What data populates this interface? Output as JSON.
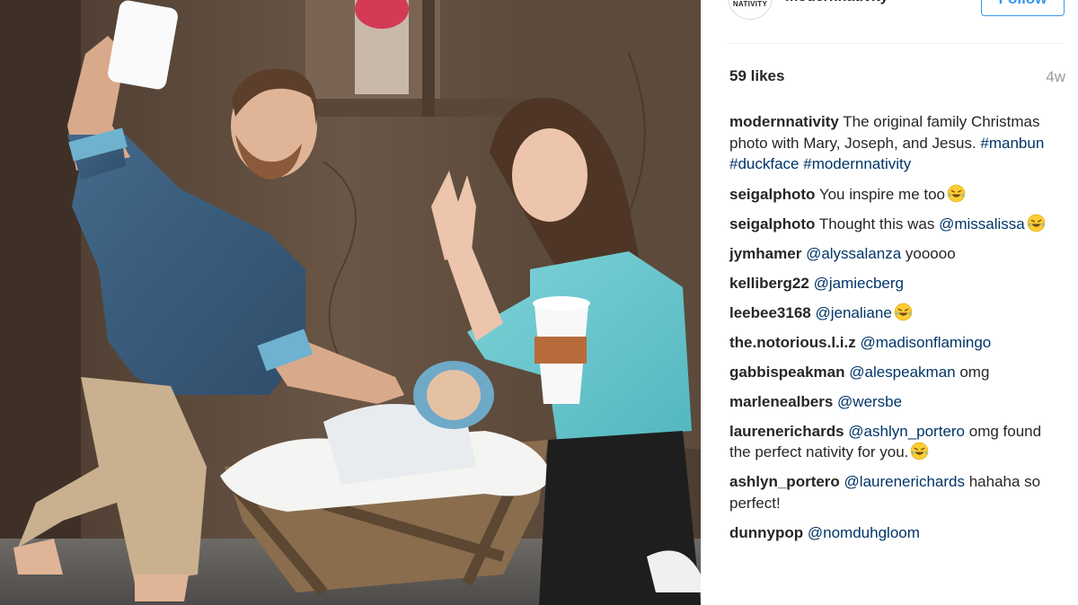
{
  "post": {
    "header": {
      "avatar_text": "NATIVITY",
      "username": "modernnativity",
      "follow_label": "Follow"
    },
    "likes": "59 likes",
    "age": "4w",
    "comments": [
      {
        "user": "modernnativity",
        "parts": [
          {
            "t": "The original family Christmas photo with Mary, Joseph, and Jesus. ",
            "k": "text"
          },
          {
            "t": "#manbun",
            "k": "tag"
          },
          {
            "t": " ",
            "k": "text"
          },
          {
            "t": "#duckface",
            "k": "tag"
          },
          {
            "t": " ",
            "k": "text"
          },
          {
            "t": "#modernnativity",
            "k": "tag"
          }
        ],
        "emoji": false
      },
      {
        "user": "seigalphoto",
        "parts": [
          {
            "t": "You inspire me too",
            "k": "text"
          }
        ],
        "emoji": true
      },
      {
        "user": "seigalphoto",
        "parts": [
          {
            "t": "Thought this was ",
            "k": "text"
          },
          {
            "t": "@missalissa",
            "k": "tag"
          }
        ],
        "emoji": true
      },
      {
        "user": "jymhamer",
        "parts": [
          {
            "t": "@alyssalanza",
            "k": "tag"
          },
          {
            "t": " yooooo",
            "k": "text"
          }
        ],
        "emoji": false
      },
      {
        "user": "kelliberg22",
        "parts": [
          {
            "t": "@jamiecberg",
            "k": "tag"
          }
        ],
        "emoji": false
      },
      {
        "user": "leebee3168",
        "parts": [
          {
            "t": "@jenaliane",
            "k": "tag"
          }
        ],
        "emoji": true
      },
      {
        "user": "the.notorious.l.i.z",
        "parts": [
          {
            "t": "@madisonflamingo",
            "k": "tag"
          }
        ],
        "emoji": false
      },
      {
        "user": "gabbispeakman",
        "parts": [
          {
            "t": "@alespeakman",
            "k": "tag"
          },
          {
            "t": " omg",
            "k": "text"
          }
        ],
        "emoji": false
      },
      {
        "user": "marlenealbers",
        "parts": [
          {
            "t": "@wersbe",
            "k": "tag"
          }
        ],
        "emoji": false
      },
      {
        "user": "laurenerichards",
        "parts": [
          {
            "t": "@ashlyn_portero",
            "k": "tag"
          },
          {
            "t": " omg found the perfect nativity for you.",
            "k": "text"
          }
        ],
        "emoji": true
      },
      {
        "user": "ashlyn_portero",
        "parts": [
          {
            "t": "@laurenerichards",
            "k": "tag"
          },
          {
            "t": " hahaha so perfect!",
            "k": "text"
          }
        ],
        "emoji": false
      },
      {
        "user": "dunnypop",
        "parts": [
          {
            "t": "@nomduhgloom",
            "k": "tag"
          }
        ],
        "emoji": false
      }
    ]
  },
  "icons": {
    "emoji": "face-with-tears-of-joy-icon"
  },
  "colors": {
    "accent": "#3897f0",
    "username": "#262626",
    "hashtag": "#003569",
    "muted": "#999999"
  }
}
